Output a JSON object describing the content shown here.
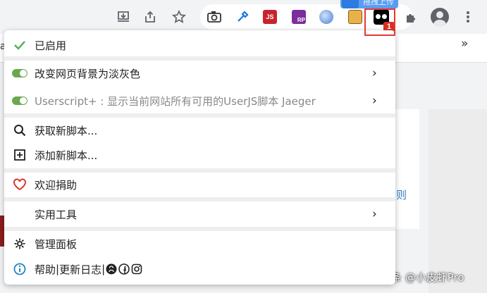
{
  "toolbar": {
    "icons": [
      "download-icon",
      "share-icon",
      "star-icon",
      "camera-icon",
      "eyedropper-icon",
      "js-extension-icon",
      "rp-extension-icon",
      "globe-extension-icon",
      "bag-extension-icon",
      "tampermonkey-icon",
      "puzzle-icon",
      "avatar-icon",
      "more-vert-icon"
    ],
    "js_label": "JS",
    "rp_label": "RP",
    "badge_count": "1",
    "blue_tag_text": "拖拽上传"
  },
  "page": {
    "left_fragment": "a",
    "chevrons": "»",
    "link_fragment": "则",
    "watermark": "头条 @小皮虾Pro"
  },
  "menu": {
    "enabled_label": "已启用",
    "scripts": [
      {
        "label": "改变网页背景为淡灰色",
        "enabled": true,
        "dim": false
      },
      {
        "label": "Userscript+ : 显示当前网站所有可用的UserJS脚本 Jaeger",
        "enabled": true,
        "dim": true
      }
    ],
    "find_scripts": "获取新脚本...",
    "add_script": "添加新脚本...",
    "donate": "欢迎捐助",
    "utilities": "实用工具",
    "dashboard": "管理面板",
    "help": "帮助",
    "divider": " | ",
    "changelog": "更新日志",
    "help_sep": " | ",
    "arrow": "›",
    "colors": {
      "toggle_on": "#6aa84f",
      "check": "#4caf50",
      "heart": "#d93025",
      "info": "#1e88c7",
      "highlight": "#e53935"
    }
  }
}
